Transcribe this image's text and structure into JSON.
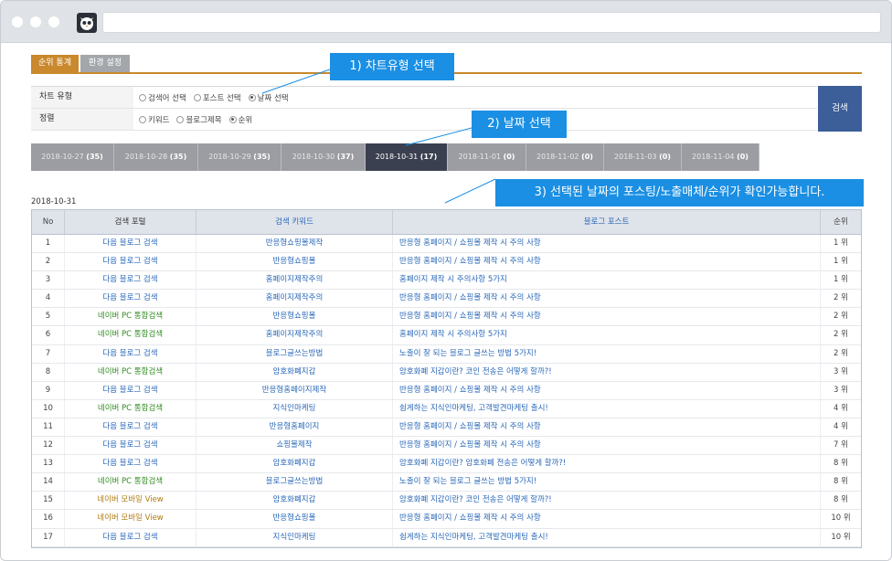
{
  "tabs": [
    "순위 통계",
    "환경 설정"
  ],
  "callouts": [
    "1) 차트유형 선택",
    "2) 날짜 선택",
    "3) 선택된 날짜의 포스팅/노출매체/순위가 확인가능합니다."
  ],
  "filters": {
    "chart_type_label": "차트 유형",
    "chart_type_options": [
      "검색어 선택",
      "포스트 선택",
      "날짜 선택"
    ],
    "sort_label": "정렬",
    "sort_options": [
      "키워드",
      "블로그제목",
      "순위"
    ]
  },
  "search_button": "검색",
  "dates": [
    {
      "date": "2018-10-27",
      "count": "(35)"
    },
    {
      "date": "2018-10-28",
      "count": "(35)"
    },
    {
      "date": "2018-10-29",
      "count": "(35)"
    },
    {
      "date": "2018-10-30",
      "count": "(37)"
    },
    {
      "date": "2018-10-31",
      "count": "(17)"
    },
    {
      "date": "2018-11-01",
      "count": "(0)"
    },
    {
      "date": "2018-11-02",
      "count": "(0)"
    },
    {
      "date": "2018-11-03",
      "count": "(0)"
    },
    {
      "date": "2018-11-04",
      "count": "(0)"
    }
  ],
  "selected_date_caption": "2018-10-31",
  "table": {
    "headers": [
      "No",
      "검색 포털",
      "검색 키워드",
      "블로그 포스트",
      "순위"
    ],
    "rows": [
      {
        "no": "1",
        "portal": "다음 블로그 검색",
        "keyword": "반응형쇼핑몰제작",
        "post": "반응형 홈페이지 / 쇼핑몰 제작 시 주의 사항",
        "rank": "1 위"
      },
      {
        "no": "2",
        "portal": "다음 블로그 검색",
        "keyword": "반응형쇼핑몰",
        "post": "반응형 홈페이지 / 쇼핑몰 제작 시 주의 사항",
        "rank": "1 위"
      },
      {
        "no": "3",
        "portal": "다음 블로그 검색",
        "keyword": "홈페이지제작주의",
        "post": "홈페이지 제작 시 주의사항 5가지",
        "rank": "1 위"
      },
      {
        "no": "4",
        "portal": "다음 블로그 검색",
        "keyword": "홈페이지제작주의",
        "post": "반응형 홈페이지 / 쇼핑몰 제작 시 주의 사항",
        "rank": "2 위"
      },
      {
        "no": "5",
        "portal": "네이버 PC 통합검색",
        "keyword": "반응형쇼핑몰",
        "post": "반응형 홈페이지 / 쇼핑몰 제작 시 주의 사항",
        "rank": "2 위"
      },
      {
        "no": "6",
        "portal": "네이버 PC 통합검색",
        "keyword": "홈페이지제작주의",
        "post": "홈페이지 제작 시 주의사항 5가지",
        "rank": "2 위"
      },
      {
        "no": "7",
        "portal": "다음 블로그 검색",
        "keyword": "블로그글쓰는방법",
        "post": "노출이 잘 되는 블로그 글쓰는 방법 5가지!",
        "rank": "2 위"
      },
      {
        "no": "8",
        "portal": "네이버 PC 통합검색",
        "keyword": "암호화폐지갑",
        "post": "암호화폐 지갑이란? 코인 전송은 어떻게 할까?!",
        "rank": "3 위"
      },
      {
        "no": "9",
        "portal": "다음 블로그 검색",
        "keyword": "반응형홈페이지제작",
        "post": "반응형 홈페이지 / 쇼핑몰 제작 시 주의 사항",
        "rank": "3 위"
      },
      {
        "no": "10",
        "portal": "네이버 PC 통합검색",
        "keyword": "지식인마케팅",
        "post": "쉽게하는 지식인마케팅, 고객발견마케팅 출시!",
        "rank": "4 위"
      },
      {
        "no": "11",
        "portal": "다음 블로그 검색",
        "keyword": "반응형홈페이지",
        "post": "반응형 홈페이지 / 쇼핑몰 제작 시 주의 사항",
        "rank": "4 위"
      },
      {
        "no": "12",
        "portal": "다음 블로그 검색",
        "keyword": "쇼핑몰제작",
        "post": "반응형 홈페이지 / 쇼핑몰 제작 시 주의 사항",
        "rank": "7 위"
      },
      {
        "no": "13",
        "portal": "다음 블로그 검색",
        "keyword": "암호화폐지갑",
        "post": "암호화폐 지갑이란? 암호화폐 전송은 어떻게 할까?!",
        "rank": "8 위"
      },
      {
        "no": "14",
        "portal": "네이버 PC 통합검색",
        "keyword": "블로그글쓰는방법",
        "post": "노출이 잘 되는 블로그 글쓰는 방법 5가지!",
        "rank": "8 위"
      },
      {
        "no": "15",
        "portal": "네이버 모바일 View",
        "keyword": "암호화폐지갑",
        "post": "암호화폐 지갑이란? 코인 전송은 어떻게 할까?!",
        "rank": "8 위"
      },
      {
        "no": "16",
        "portal": "네이버 모바일 View",
        "keyword": "반응형쇼핑몰",
        "post": "반응형 홈페이지 / 쇼핑몰 제작 시 주의 사항",
        "rank": "10 위"
      },
      {
        "no": "17",
        "portal": "다음 블로그 검색",
        "keyword": "지식인마케팅",
        "post": "쉽게하는 지식인마케팅, 고객발견마케팅 출시!",
        "rank": "10 위"
      }
    ]
  }
}
